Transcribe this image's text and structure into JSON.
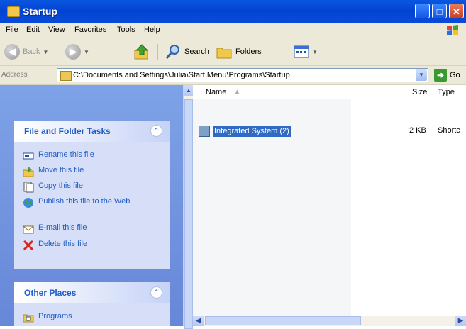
{
  "window": {
    "title": "Startup",
    "buttons": {
      "minimize": "_",
      "maximize": "□",
      "close": "✕"
    }
  },
  "menu": [
    "File",
    "Edit",
    "View",
    "Favorites",
    "Tools",
    "Help"
  ],
  "toolbar": {
    "back_label": "Back",
    "search_label": "Search",
    "folders_label": "Folders",
    "icons": {
      "back": "back-arrow-icon",
      "forward": "forward-arrow-icon",
      "up": "up-folder-icon",
      "search": "search-icon",
      "folders": "folders-icon",
      "views": "views-icon"
    }
  },
  "address": {
    "label": "Address",
    "path": "C:\\Documents and Settings\\Julia\\Start Menu\\Programs\\Startup",
    "go_label": "Go"
  },
  "sidebar": {
    "file_tasks": {
      "title": "File and Folder Tasks",
      "items": [
        {
          "label": "Rename this file"
        },
        {
          "label": "Move this file"
        },
        {
          "label": "Copy this file"
        },
        {
          "label": "Publish this file to the Web"
        },
        {
          "label": "E-mail this file"
        },
        {
          "label": "Delete this file"
        }
      ]
    },
    "other_places": {
      "title": "Other Places",
      "items": [
        {
          "label": "Programs"
        }
      ]
    }
  },
  "list": {
    "columns": {
      "name": "Name",
      "size": "Size",
      "type": "Type"
    },
    "rows": [
      {
        "name": "Integrated System (2)",
        "size": "2 KB",
        "type": "Shortc"
      }
    ]
  },
  "colors": {
    "titlebar": "#0343d2",
    "sidebar": "#6f8fdc",
    "link": "#215dc6",
    "selection": "#316ac5"
  }
}
